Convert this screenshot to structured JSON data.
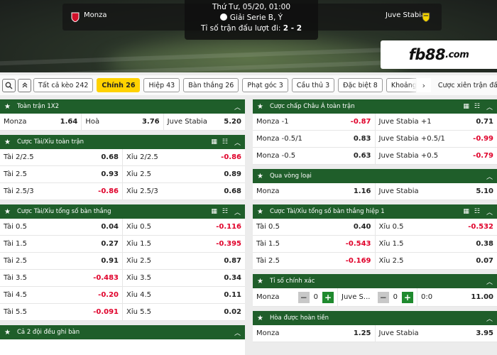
{
  "header": {
    "datetime": "Thứ Tư, 05/20, 01:00",
    "league": "Giải Serie B, Ý",
    "first_leg": "Tỉ số trận đấu lượt đi: ",
    "first_leg_score": "2 - 2",
    "home_team": "Monza",
    "away_team": "Juve Stabia",
    "brand": "fb88",
    "brand_suffix": ".com"
  },
  "tabs": [
    "Tất cả kèo 242",
    "Chính 26",
    "Hiệp 43",
    "Bàn thắng 26",
    "Phạt góc 3",
    "Cầu thủ 3",
    "Đặc biệt 8",
    "Khoảng t"
  ],
  "combo_label": "Cược xiên trận đấu",
  "left": {
    "p1": {
      "title": "Toàn trận 1X2",
      "rows": [
        [
          [
            "Monza",
            "1.64"
          ],
          [
            "Hoà",
            "3.76"
          ],
          [
            "Juve Stabia",
            "5.20"
          ]
        ]
      ]
    },
    "p2": {
      "title": "Cược Tài/Xỉu toàn trận",
      "rows": [
        [
          [
            "Tài 2/2.5",
            "0.68"
          ],
          [
            "Xỉu 2/2.5",
            "-0.86"
          ]
        ],
        [
          [
            "Tài 2.5",
            "0.93"
          ],
          [
            "Xỉu 2.5",
            "0.89"
          ]
        ],
        [
          [
            "Tài 2.5/3",
            "-0.86"
          ],
          [
            "Xỉu 2.5/3",
            "0.68"
          ]
        ]
      ]
    },
    "p3": {
      "title": "Cược Tài/Xỉu tổng số bàn thắng",
      "rows": [
        [
          [
            "Tài 0.5",
            "0.04"
          ],
          [
            "Xỉu 0.5",
            "-0.116"
          ]
        ],
        [
          [
            "Tài 1.5",
            "0.27"
          ],
          [
            "Xỉu 1.5",
            "-0.395"
          ]
        ],
        [
          [
            "Tài 2.5",
            "0.91"
          ],
          [
            "Xỉu 2.5",
            "0.87"
          ]
        ],
        [
          [
            "Tài 3.5",
            "-0.483"
          ],
          [
            "Xỉu 3.5",
            "0.34"
          ]
        ],
        [
          [
            "Tài 4.5",
            "-0.20"
          ],
          [
            "Xỉu 4.5",
            "0.11"
          ]
        ],
        [
          [
            "Tài 5.5",
            "-0.091"
          ],
          [
            "Xỉu 5.5",
            "0.02"
          ]
        ]
      ]
    },
    "p4": {
      "title": "Cả 2 đội đều ghi bàn"
    }
  },
  "right": {
    "p1": {
      "title": "Cược chấp Châu Á toàn trận",
      "rows": [
        [
          [
            "Monza -1",
            "-0.87"
          ],
          [
            "Juve Stabia +1",
            "0.71"
          ]
        ],
        [
          [
            "Monza -0.5/1",
            "0.83"
          ],
          [
            "Juve Stabia +0.5/1",
            "-0.99"
          ]
        ],
        [
          [
            "Monza -0.5",
            "0.63"
          ],
          [
            "Juve Stabia +0.5",
            "-0.79"
          ]
        ]
      ]
    },
    "p2": {
      "title": "Qua vòng loại",
      "rows": [
        [
          [
            "Monza",
            "1.16"
          ],
          [
            "Juve Stabia",
            "5.10"
          ]
        ]
      ]
    },
    "p3": {
      "title": "Cược Tài/Xỉu tổng số bàn thắng hiệp 1",
      "rows": [
        [
          [
            "Tài 0.5",
            "0.40"
          ],
          [
            "Xỉu 0.5",
            "-0.532"
          ]
        ],
        [
          [
            "Tài 1.5",
            "-0.543"
          ],
          [
            "Xỉu 1.5",
            "0.38"
          ]
        ],
        [
          [
            "Tài 2.5",
            "-0.169"
          ],
          [
            "Xỉu 2.5",
            "0.07"
          ]
        ]
      ]
    },
    "p4": {
      "title": "Tỉ số chính xác",
      "home": "Monza",
      "home_val": "0",
      "away": "Juve S...",
      "away_val": "0",
      "score": "0:0",
      "odds": "11.00"
    },
    "p5": {
      "title": "Hòa được hoàn tiền",
      "rows": [
        [
          [
            "Monza",
            "1.25"
          ],
          [
            "Juve Stabia",
            "3.95"
          ]
        ]
      ]
    }
  },
  "colors": {
    "accent": "#ffd200",
    "header_green": "#1f5e2a",
    "negative": "#e0002a",
    "plus_button": "#1f8a2e"
  }
}
